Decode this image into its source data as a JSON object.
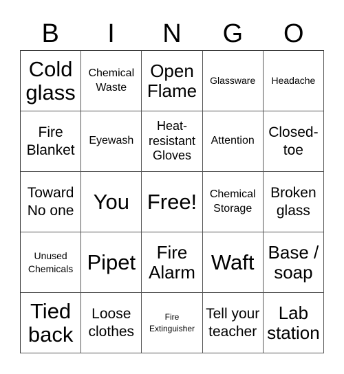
{
  "header": {
    "letters": [
      "B",
      "I",
      "N",
      "G",
      "O"
    ]
  },
  "rows": [
    [
      "Cold glass",
      "Chemical Waste",
      "Open Flame",
      "Glassware",
      "Headache"
    ],
    [
      "Fire Blanket",
      "Eyewash",
      "Heat-resistant Gloves",
      "Attention",
      "Closed-toe"
    ],
    [
      "Toward No one",
      "You",
      "Free!",
      "Chemical Storage",
      "Broken glass"
    ],
    [
      "Unused Chemicals",
      "Pipet",
      "Fire Alarm",
      "Waft",
      "Base / soap"
    ],
    [
      "Tied back",
      "Loose clothes",
      "Fire Extinguisher",
      "Tell your teacher",
      "Lab station"
    ]
  ]
}
